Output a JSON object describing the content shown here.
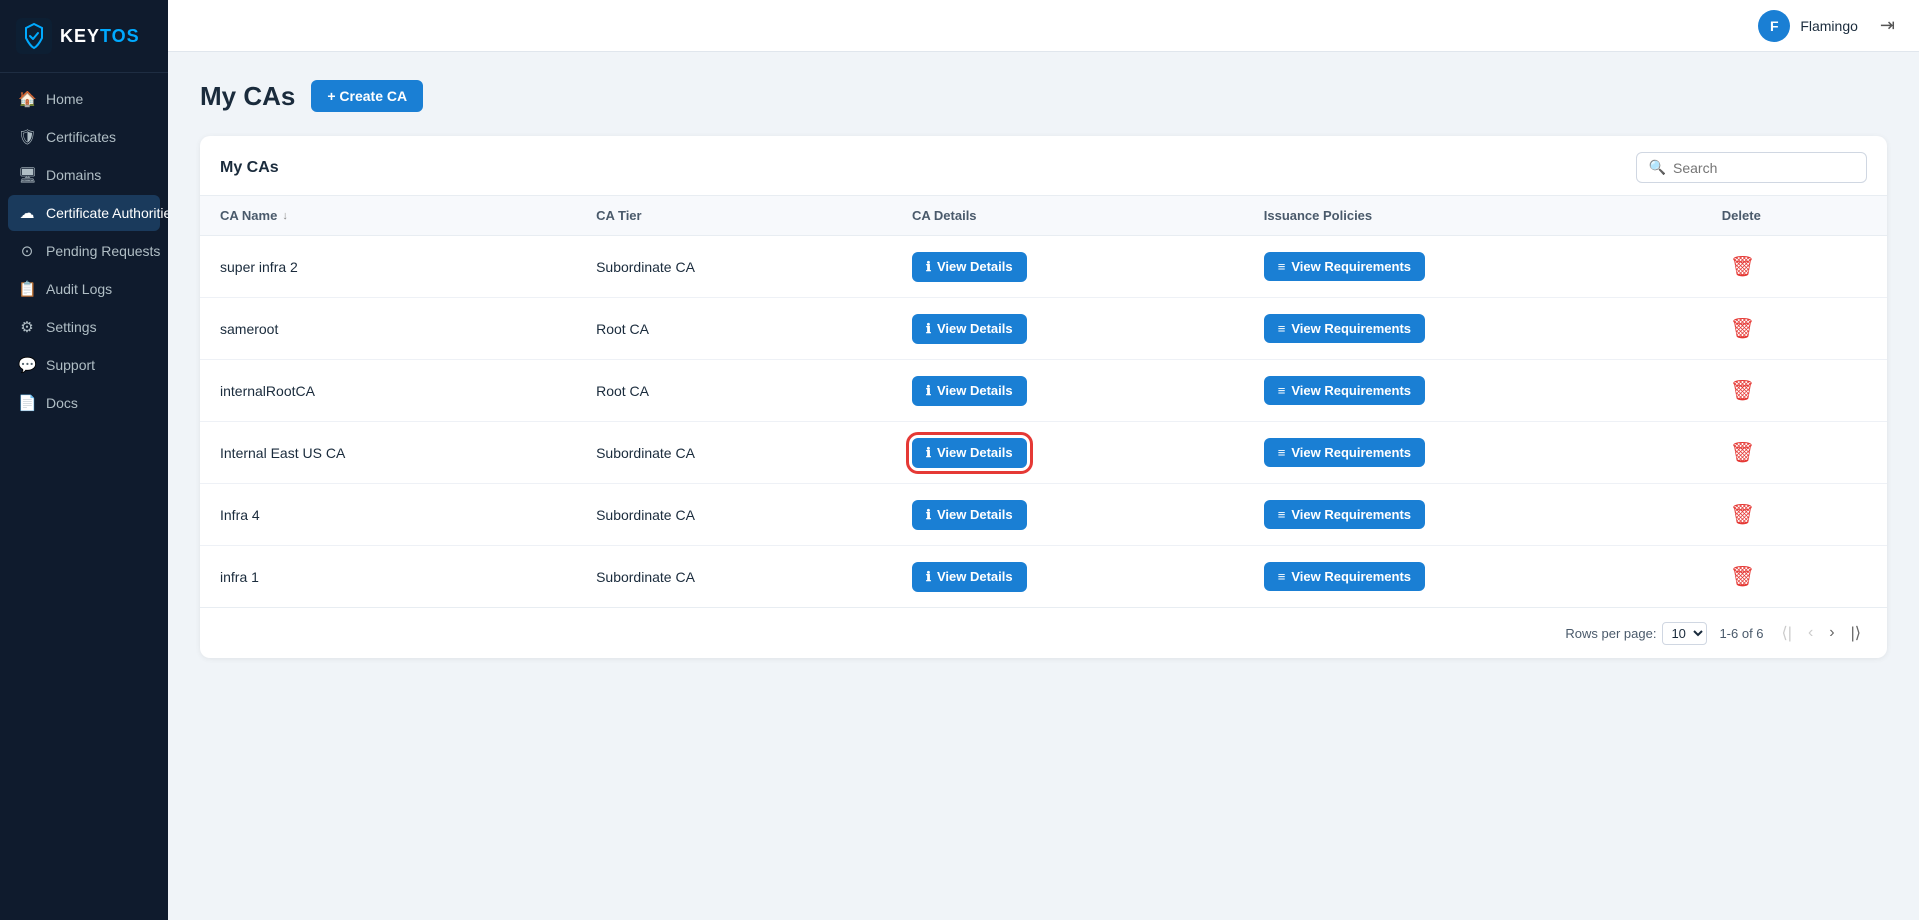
{
  "sidebar": {
    "logo": {
      "key": "KEY",
      "tos": "TOS"
    },
    "items": [
      {
        "id": "home",
        "label": "Home",
        "icon": "🏠",
        "active": false
      },
      {
        "id": "certificates",
        "label": "Certificates",
        "icon": "🛡",
        "active": false
      },
      {
        "id": "domains",
        "label": "Domains",
        "icon": "🖥",
        "active": false
      },
      {
        "id": "certificate-authorities",
        "label": "Certificate Authorities",
        "icon": "☁",
        "active": true
      },
      {
        "id": "pending-requests",
        "label": "Pending Requests",
        "icon": "⊙",
        "active": false
      },
      {
        "id": "audit-logs",
        "label": "Audit Logs",
        "icon": "📋",
        "active": false
      },
      {
        "id": "settings",
        "label": "Settings",
        "icon": "⚙",
        "active": false
      },
      {
        "id": "support",
        "label": "Support",
        "icon": "💬",
        "active": false
      },
      {
        "id": "docs",
        "label": "Docs",
        "icon": "📄",
        "active": false
      }
    ]
  },
  "header": {
    "user": {
      "initial": "F",
      "name": "Flamingo"
    },
    "logout_icon": "⇥"
  },
  "page": {
    "title": "My CAs",
    "create_button": "+ Create CA"
  },
  "table": {
    "title": "My CAs",
    "search_placeholder": "Search",
    "columns": [
      {
        "key": "ca_name",
        "label": "CA Name",
        "sortable": true
      },
      {
        "key": "ca_tier",
        "label": "CA Tier",
        "sortable": false
      },
      {
        "key": "ca_details",
        "label": "CA Details",
        "sortable": false
      },
      {
        "key": "issuance_policies",
        "label": "Issuance Policies",
        "sortable": false
      },
      {
        "key": "delete",
        "label": "Delete",
        "sortable": false
      }
    ],
    "rows": [
      {
        "id": 1,
        "ca_name": "super infra 2",
        "ca_tier": "Subordinate CA",
        "highlighted": false
      },
      {
        "id": 2,
        "ca_name": "sameroot",
        "ca_tier": "Root CA",
        "highlighted": false
      },
      {
        "id": 3,
        "ca_name": "internalRootCA",
        "ca_tier": "Root CA",
        "highlighted": false
      },
      {
        "id": 4,
        "ca_name": "Internal East US CA",
        "ca_tier": "Subordinate CA",
        "highlighted": true
      },
      {
        "id": 5,
        "ca_name": "Infra 4",
        "ca_tier": "Subordinate CA",
        "highlighted": false
      },
      {
        "id": 6,
        "ca_name": "infra 1",
        "ca_tier": "Subordinate CA",
        "highlighted": false
      }
    ],
    "view_details_label": "View Details",
    "view_requirements_label": "View Requirements",
    "pagination": {
      "rows_per_page_label": "Rows per page:",
      "rows_per_page_value": "10",
      "range": "1-6 of 6"
    }
  }
}
